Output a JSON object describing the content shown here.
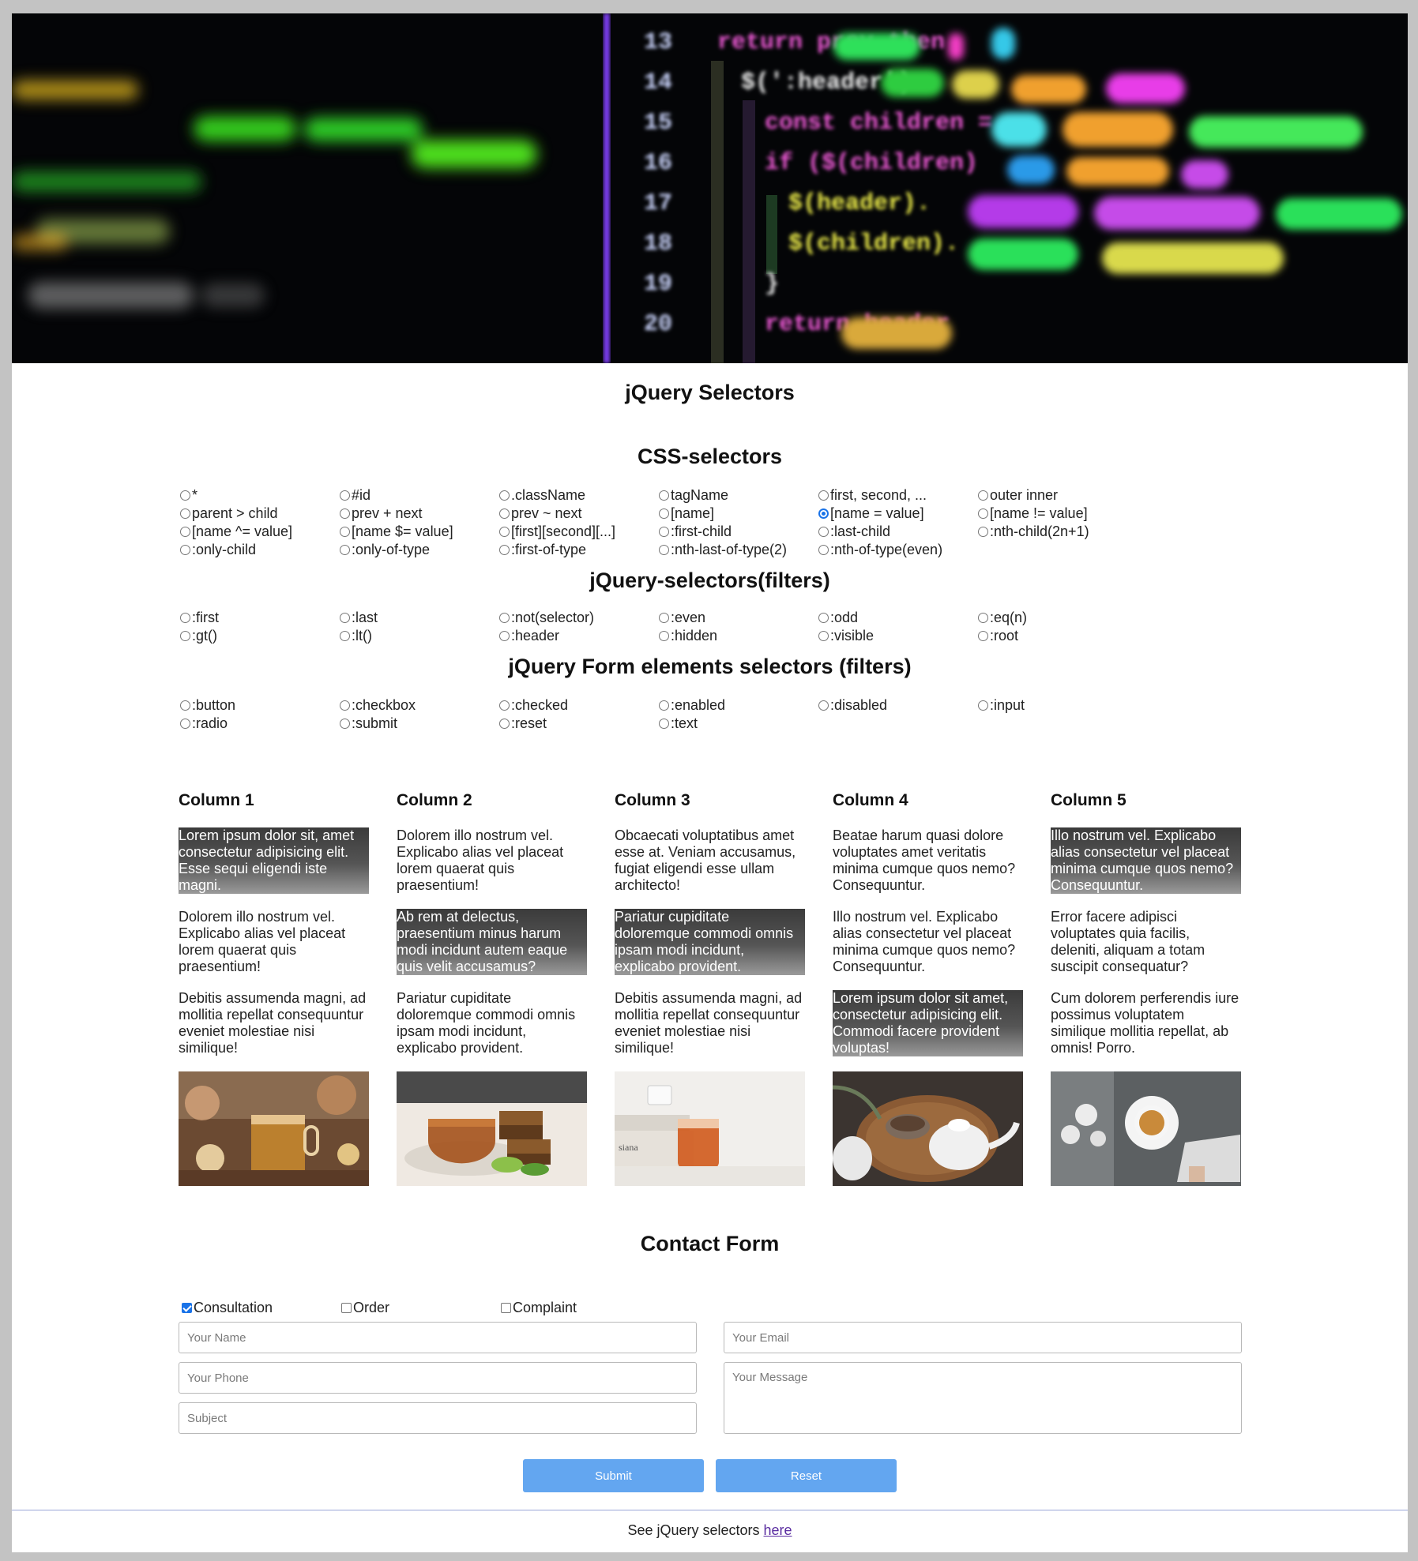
{
  "title": "jQuery Selectors",
  "sections": [
    {
      "title": "CSS-selectors",
      "options": [
        "*",
        "#id",
        ".className",
        "tagName",
        "first, second, ...",
        "outer inner",
        "parent > child",
        "prev + next",
        "prev ~ next",
        "[name]",
        "[name = value]",
        "[name != value]",
        "[name ^= value]",
        "[name $= value]",
        "[first][second][...]",
        ":first-child",
        ":last-child",
        ":nth-child(2n+1)",
        ":only-child",
        ":only-of-type",
        ":first-of-type",
        ":nth-last-of-type(2)",
        ":nth-of-type(even)"
      ],
      "selected": "[name = value]"
    },
    {
      "title": "jQuery-selectors(filters)",
      "options": [
        ":first",
        ":last",
        ":not(selector)",
        ":even",
        ":odd",
        ":eq(n)",
        ":gt()",
        ":lt()",
        ":header",
        ":hidden",
        ":visible",
        ":root"
      ],
      "selected": null
    },
    {
      "title": "jQuery Form elements selectors (filters)",
      "options": [
        ":button",
        ":checkbox",
        ":checked",
        ":enabled",
        ":disabled",
        ":input",
        ":radio",
        ":submit",
        ":reset",
        ":text"
      ],
      "selected": null
    }
  ],
  "columns": [
    {
      "title": "Column 1",
      "paragraphs": [
        {
          "text": "Lorem ipsum dolor sit, amet consectetur adipisicing elit. Esse sequi eligendi iste magni.",
          "highlighted": true
        },
        {
          "text": "Dolorem illo nostrum vel. Explicabo alias vel placeat lorem quaerat quis praesentium!",
          "highlighted": false
        },
        {
          "text": "Debitis assumenda magni, ad mollitia repellat consequuntur eveniet molestiae nisi similique!",
          "highlighted": false
        }
      ],
      "image": "tea-glass-with-lights"
    },
    {
      "title": "Column 2",
      "paragraphs": [
        {
          "text": "Dolorem illo nostrum vel. Explicabo alias vel placeat lorem quaerat quis praesentium!",
          "highlighted": false
        },
        {
          "text": "Ab rem at delectus, praesentium minus harum modi incidunt autem eaque quis velit accusamus?",
          "highlighted": true
        },
        {
          "text": "Pariatur cupiditate doloremque commodi omnis ipsam modi incidunt, explicabo provident.",
          "highlighted": false
        }
      ],
      "image": "tea-cup-with-cake"
    },
    {
      "title": "Column 3",
      "paragraphs": [
        {
          "text": "Obcaecati voluptatibus amet esse at. Veniam accusamus, fugiat eligendi esse ullam architecto!",
          "highlighted": false
        },
        {
          "text": "Pariatur cupiditate doloremque commodi omnis ipsam modi incidunt, explicabo provident.",
          "highlighted": true
        },
        {
          "text": "Debitis assumenda magni, ad mollitia repellat consequuntur eveniet molestiae nisi similique!",
          "highlighted": false
        }
      ],
      "image": "tea-glass-with-books"
    },
    {
      "title": "Column 4",
      "paragraphs": [
        {
          "text": "Beatae harum quasi dolore voluptates amet veritatis minima cumque quos nemo? Consequuntur.",
          "highlighted": false
        },
        {
          "text": "Illo nostrum vel. Explicabo alias consectetur vel placeat minima cumque quos nemo? Consequuntur.",
          "highlighted": false
        },
        {
          "text": "Lorem ipsum dolor sit amet, consectetur adipisicing elit. Commodi facere provident voluptas!",
          "highlighted": true
        }
      ],
      "image": "teapot-on-tray"
    },
    {
      "title": "Column 5",
      "paragraphs": [
        {
          "text": "Illo nostrum vel. Explicabo alias consectetur vel placeat minima cumque quos nemo? Consequuntur.",
          "highlighted": true
        },
        {
          "text": "Error facere adipisci voluptates quia facilis, deleniti, aliquam a totam suscipit consequatur?",
          "highlighted": false
        },
        {
          "text": "Cum dolorem perferendis iure possimus voluptatem similique mollitia repellat, ab omnis! Porro.",
          "highlighted": false
        }
      ],
      "image": "tea-cup-with-flowers"
    }
  ],
  "contact": {
    "title": "Contact Form",
    "checkboxes": [
      {
        "label": "Consultation",
        "checked": true
      },
      {
        "label": "Order",
        "checked": false
      },
      {
        "label": "Complaint",
        "checked": false
      }
    ],
    "name_placeholder": "Your Name",
    "phone_placeholder": "Your Phone",
    "subject_placeholder": "Subject",
    "email_placeholder": "Your Email",
    "message_placeholder": "Your Message",
    "submit_label": "Submit",
    "reset_label": "Reset"
  },
  "footer": {
    "text": "See jQuery selectors ",
    "link": "here"
  },
  "hero": {
    "code_lines": [
      {
        "num": "13",
        "code": "return prev.then"
      },
      {
        "num": "14",
        "code": "$(':header')."
      },
      {
        "num": "15",
        "code": "const children ="
      },
      {
        "num": "16",
        "code": "if ($(children)"
      },
      {
        "num": "17",
        "code": "$(header)."
      },
      {
        "num": "18",
        "code": "$(children)."
      },
      {
        "num": "19",
        "code": "}"
      },
      {
        "num": "20",
        "code": "return header"
      }
    ]
  },
  "colors": {
    "accent": "#63a6f0",
    "check": "#1a73e8",
    "link": "#5a2ca0"
  }
}
